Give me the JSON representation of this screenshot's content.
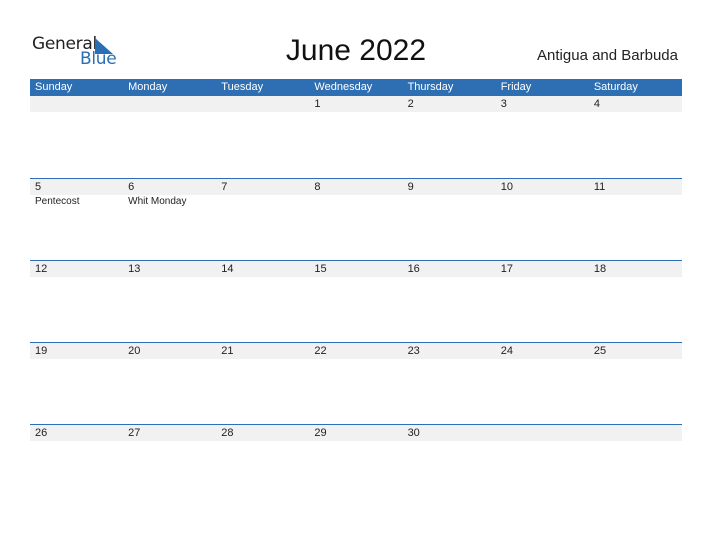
{
  "logo": {
    "line1": "General",
    "line2": "Blue"
  },
  "title": "June 2022",
  "country": "Antigua and Barbuda",
  "colors": {
    "accent": "#2e6fb3",
    "date_strip": "#f1f1f1"
  },
  "weekdays": [
    "Sunday",
    "Monday",
    "Tuesday",
    "Wednesday",
    "Thursday",
    "Friday",
    "Saturday"
  ],
  "weeks": [
    {
      "dates": [
        "",
        "",
        "",
        "1",
        "2",
        "3",
        "4"
      ],
      "events": [
        "",
        "",
        "",
        "",
        "",
        "",
        ""
      ]
    },
    {
      "dates": [
        "5",
        "6",
        "7",
        "8",
        "9",
        "10",
        "11"
      ],
      "events": [
        "Pentecost",
        "Whit Monday",
        "",
        "",
        "",
        "",
        ""
      ]
    },
    {
      "dates": [
        "12",
        "13",
        "14",
        "15",
        "16",
        "17",
        "18"
      ],
      "events": [
        "",
        "",
        "",
        "",
        "",
        "",
        ""
      ]
    },
    {
      "dates": [
        "19",
        "20",
        "21",
        "22",
        "23",
        "24",
        "25"
      ],
      "events": [
        "",
        "",
        "",
        "",
        "",
        "",
        ""
      ]
    },
    {
      "dates": [
        "26",
        "27",
        "28",
        "29",
        "30",
        "",
        ""
      ],
      "events": [
        "",
        "",
        "",
        "",
        "",
        "",
        ""
      ]
    }
  ]
}
